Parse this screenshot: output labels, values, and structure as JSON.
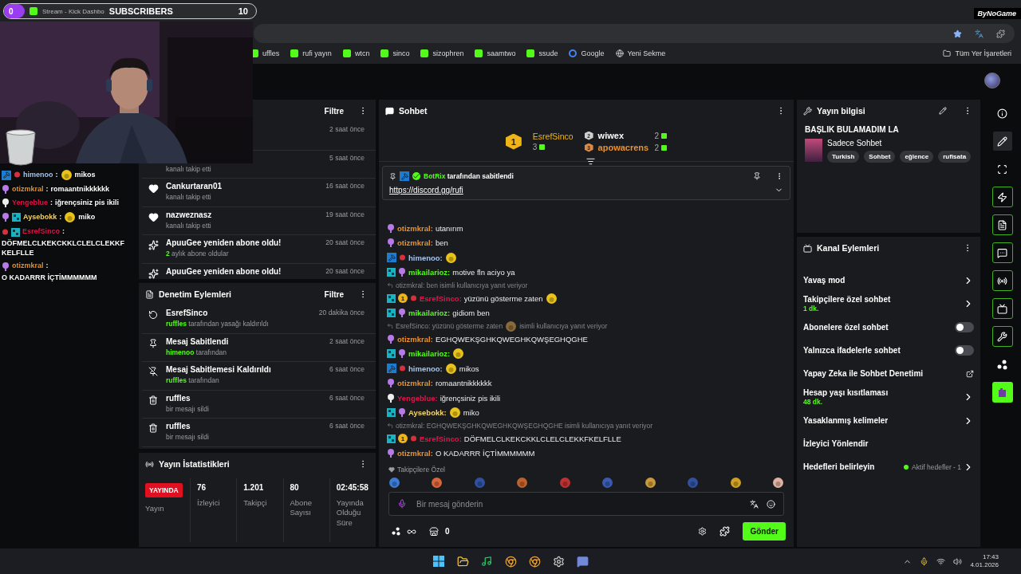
{
  "browser": {
    "bookmarks": [
      {
        "label": "uffles",
        "kind": "kick"
      },
      {
        "label": "rufi yayın",
        "kind": "kick"
      },
      {
        "label": "wtcn",
        "kind": "kick"
      },
      {
        "label": "sinco",
        "kind": "kick"
      },
      {
        "label": "sizophren",
        "kind": "kick"
      },
      {
        "label": "saamtwo",
        "kind": "kick"
      },
      {
        "label": "ssude",
        "kind": "kick"
      },
      {
        "label": "Google",
        "kind": "google"
      },
      {
        "label": "Yeni Sekme",
        "kind": "globe"
      }
    ],
    "all_bookmarks": "Tüm Yer İşaretleri"
  },
  "overlay": {
    "count": "0",
    "tab_title": "Stream - Kick Dashbo",
    "label": "SUBSCRIBERS",
    "goal": "10",
    "brand": "ByNoGame"
  },
  "overlay_chat": [
    {
      "user": "himenoo",
      "color": "#a3c4f3",
      "badges": [
        {
          "kind": "mod"
        },
        {
          "kind": "vip"
        }
      ],
      "sep": ":",
      "parts": [
        {
          "kind": "emote"
        },
        {
          "kind": "text",
          "text": "mikos"
        }
      ]
    },
    {
      "user": "otizmkral",
      "color": "#e8912d",
      "badges": [
        {
          "kind": "sub"
        }
      ],
      "sep": ":",
      "parts": [
        {
          "kind": "text",
          "text": "romaantnikkkkkk"
        }
      ]
    },
    {
      "user": "Yengeblue",
      "color": "#e0144c",
      "badges": [
        {
          "kind": "gifter"
        }
      ],
      "sep": ":",
      "parts": [
        {
          "kind": "text",
          "text": "iğrençsiniz pis ikili"
        }
      ]
    },
    {
      "user": "Aysebokk",
      "color": "#f5d56a",
      "badges": [
        {
          "kind": "sub"
        },
        {
          "kind": "og"
        }
      ],
      "sep": ":",
      "parts": [
        {
          "kind": "emote"
        },
        {
          "kind": "text",
          "text": "miko"
        }
      ]
    },
    {
      "user": "EsrefSinco",
      "color": "#e0144c",
      "badges": [
        {
          "kind": "vip"
        },
        {
          "kind": "og"
        }
      ],
      "sep": ":",
      "parts": [
        {
          "kind": "text",
          "text": "DÖFMELCLKEKCKKLCLELCLEKKFKELFLLE"
        }
      ]
    },
    {
      "user": "otizmkral",
      "color": "#e8912d",
      "badges": [
        {
          "kind": "sub"
        }
      ],
      "sep": ":",
      "parts": [
        {
          "kind": "text",
          "text": "O KADARRR İÇTİMMMMMM"
        }
      ]
    }
  ],
  "events": {
    "filter": "Filtre",
    "items": [
      {
        "time": "2 saat önce"
      },
      {
        "subtitle": "kanalı takip etti",
        "time": "5 saat önce"
      },
      {
        "kind": "follow",
        "name": "Cankurtaran01",
        "subtitle": "kanalı takip etti",
        "time": "16 saat önce"
      },
      {
        "kind": "follow",
        "name": "nazweznasz",
        "subtitle": "kanalı takip etti",
        "time": "19 saat önce"
      },
      {
        "kind": "resub",
        "name": "ApuuGee yeniden abone oldu!",
        "months": "2",
        "subtitle": "aylık abone oldular",
        "time": "20 saat önce"
      },
      {
        "kind": "resub",
        "name": "ApuuGee yeniden abone oldu!",
        "time": "20 saat önce"
      }
    ]
  },
  "moderation": {
    "title": "Denetim Eylemleri",
    "filter": "Filtre",
    "items": [
      {
        "kind": "unban",
        "name": "EsrefSinco",
        "actor": "ruffles",
        "subtitle": "tarafından yasağı kaldırıldı",
        "time": "20 dakika önce"
      },
      {
        "kind": "pin",
        "name": "Mesaj Sabitlendi",
        "actor": "himenoo",
        "subtitle": "tarafından",
        "time": "2 saat önce"
      },
      {
        "kind": "unpin",
        "name": "Mesaj Sabitlemesi Kaldırıldı",
        "actor": "ruffles",
        "subtitle": "tarafından",
        "time": "6 saat önce"
      },
      {
        "kind": "delete",
        "name": "ruffles",
        "subtitle": "bir mesajı sildi",
        "time": "6 saat önce"
      },
      {
        "kind": "delete",
        "name": "ruffles",
        "subtitle": "bir mesajı sildi",
        "time": "6 saat önce"
      }
    ]
  },
  "stats": {
    "title": "Yayın İstatistikleri",
    "live": "YAYINDA",
    "live_label": "Yayın",
    "items": [
      {
        "value": "76",
        "label": "İzleyici"
      },
      {
        "value": "1.201",
        "label": "Takipçi"
      },
      {
        "value": "80",
        "label": "Abone Sayısı"
      },
      {
        "value": "02:45:58",
        "label": "Yayında Olduğu Süre"
      }
    ]
  },
  "chat": {
    "title": "Sohbet",
    "leader": {
      "rank": "1",
      "name": "EsrefSinco",
      "count": "3"
    },
    "runners": [
      {
        "rank": "2",
        "name": "wiwex",
        "count": "2",
        "color": "#ffffff"
      },
      {
        "rank": "3",
        "name": "apowacrens",
        "count": "2",
        "color": "#e8912d"
      }
    ],
    "pinned": {
      "by": "BotRix",
      "text": "tarafından sabitlendi",
      "link": "https://discord.gg/rufi"
    },
    "messages": [
      {
        "kind": "message",
        "user": "otizmkral:",
        "color": "#e8912d",
        "badges": [
          {
            "kind": "sub"
          }
        ],
        "parts": [
          {
            "kind": "text",
            "text": "utanırım"
          }
        ]
      },
      {
        "kind": "message",
        "user": "otizmkral:",
        "color": "#e8912d",
        "badges": [
          {
            "kind": "sub"
          }
        ],
        "parts": [
          {
            "kind": "text",
            "text": "ben"
          }
        ]
      },
      {
        "kind": "message",
        "user": "himenoo:",
        "color": "#a3c4f3",
        "badges": [
          {
            "kind": "mod"
          },
          {
            "kind": "vip"
          }
        ],
        "parts": [
          {
            "kind": "emote"
          }
        ]
      },
      {
        "kind": "message",
        "user": "mikailarioz:",
        "color": "#53fc18",
        "badges": [
          {
            "kind": "og"
          },
          {
            "kind": "sub"
          }
        ],
        "parts": [
          {
            "kind": "text",
            "text": "motive fln aciyo ya"
          }
        ]
      },
      {
        "kind": "reply",
        "text": "otizmkral: ben isimli kullanıcıya yanıt veriyor"
      },
      {
        "kind": "message",
        "user": "EsrefSinco:",
        "color": "#e0144c",
        "badges": [
          {
            "kind": "og"
          },
          {
            "kind": "rank",
            "rank": "1"
          },
          {
            "kind": "vip"
          }
        ],
        "parts": [
          {
            "kind": "text",
            "text": "yüzünü gösterme zaten"
          },
          {
            "kind": "emote"
          }
        ]
      },
      {
        "kind": "message",
        "user": "mikailarioz:",
        "color": "#53fc18",
        "badges": [
          {
            "kind": "og"
          },
          {
            "kind": "sub"
          }
        ],
        "parts": [
          {
            "kind": "text",
            "text": "gidiom ben"
          }
        ]
      },
      {
        "kind": "reply",
        "text": "EsrefSinco: yüzünü gösterme zaten",
        "rest": "isimli kullanıcıya yanıt veriyor"
      },
      {
        "kind": "message",
        "user": "otizmkral:",
        "color": "#e8912d",
        "badges": [
          {
            "kind": "sub"
          }
        ],
        "parts": [
          {
            "kind": "text",
            "text": "EGHQWEKŞGHKQWEGHKQWŞEGHQGHE"
          }
        ]
      },
      {
        "kind": "message",
        "user": "mikailarioz:",
        "color": "#53fc18",
        "badges": [
          {
            "kind": "og"
          },
          {
            "kind": "sub"
          }
        ],
        "parts": [
          {
            "kind": "emote"
          }
        ]
      },
      {
        "kind": "message",
        "user": "himenoo:",
        "color": "#a3c4f3",
        "badges": [
          {
            "kind": "mod"
          },
          {
            "kind": "vip"
          }
        ],
        "parts": [
          {
            "kind": "emote"
          },
          {
            "kind": "text",
            "text": "mikos"
          }
        ]
      },
      {
        "kind": "message",
        "user": "otizmkral:",
        "color": "#e8912d",
        "badges": [
          {
            "kind": "sub"
          }
        ],
        "parts": [
          {
            "kind": "text",
            "text": "romaantnikkkkkk"
          }
        ]
      },
      {
        "kind": "message",
        "user": "Yengeblue:",
        "color": "#e0144c",
        "badges": [
          {
            "kind": "gifter"
          }
        ],
        "parts": [
          {
            "kind": "text",
            "text": "iğrençsiniz pis ikili"
          }
        ]
      },
      {
        "kind": "message",
        "user": "Aysebokk:",
        "color": "#f5d56a",
        "badges": [
          {
            "kind": "og"
          },
          {
            "kind": "sub"
          }
        ],
        "parts": [
          {
            "kind": "emote"
          },
          {
            "kind": "text",
            "text": "miko"
          }
        ]
      },
      {
        "kind": "reply",
        "text": "otizmkral: EGHQWEKŞGHKQWEGHKQWŞEGHQGHE isimli kullanıcıya yanıt veriyor"
      },
      {
        "kind": "message",
        "user": "EsrefSinco:",
        "color": "#e0144c",
        "badges": [
          {
            "kind": "og"
          },
          {
            "kind": "rank",
            "rank": "1"
          },
          {
            "kind": "vip"
          }
        ],
        "parts": [
          {
            "kind": "text",
            "text": "DÖFMELCLKEKCKKLCLELCLEKKFKELFLLE"
          }
        ]
      },
      {
        "kind": "message",
        "user": "otizmkral:",
        "color": "#e8912d",
        "badges": [
          {
            "kind": "sub"
          }
        ],
        "parts": [
          {
            "kind": "text",
            "text": "O KADARRR İÇTİMMMMMM"
          }
        ]
      }
    ],
    "emote_section": "Takipçilere Özel",
    "placeholder": "Bir mesaj gönderin",
    "points": "0",
    "send": "Gönder"
  },
  "stream_info": {
    "title": "Yayın bilgisi",
    "stream_title": "BAŞLIK BULAMADIM LA",
    "category": "Sadece Sohbet",
    "tags": [
      "Turkish",
      "Sohbet",
      "eğlence",
      "rufisata"
    ]
  },
  "channel_actions": {
    "title": "Kanal Eylemleri",
    "items": [
      {
        "kind": "link",
        "label": "Yavaş mod"
      },
      {
        "kind": "link",
        "label": "Takipçilere özel sohbet",
        "value": "1 dk."
      },
      {
        "kind": "toggle",
        "label": "Abonelere özel sohbet",
        "on": false
      },
      {
        "kind": "toggle",
        "label": "Yalnızca ifadelerle sohbet",
        "on": false
      },
      {
        "kind": "external",
        "label": "Yapay Zeka ile Sohbet Denetimi"
      },
      {
        "kind": "link",
        "label": "Hesap yaşı kısıtlaması",
        "value": "48 dk."
      },
      {
        "kind": "link",
        "label": "Yasaklanmış kelimeler"
      },
      {
        "kind": "plain",
        "label": "İzleyici Yönlendir"
      },
      {
        "kind": "goal",
        "label": "Hedefleri belirleyin",
        "status": "Aktif hedefler - 1"
      }
    ]
  },
  "rail": [
    {
      "kind": "info",
      "selected": false,
      "added": false
    },
    {
      "kind": "edit",
      "selected": true,
      "added": false
    },
    {
      "kind": "scan",
      "selected": false,
      "added": false
    },
    {
      "kind": "bolt",
      "selected": false,
      "added": true
    },
    {
      "kind": "doc",
      "selected": false,
      "added": true
    },
    {
      "kind": "chat",
      "selected": false,
      "added": true
    },
    {
      "kind": "broadcast",
      "selected": false,
      "added": true
    },
    {
      "kind": "layout",
      "selected": false,
      "added": true
    },
    {
      "kind": "wrench",
      "selected": false,
      "added": true
    },
    {
      "kind": "dots",
      "selected": false,
      "added": false
    },
    {
      "kind": "app",
      "selected": false,
      "added": false
    }
  ],
  "taskbar": {
    "time": "17:43",
    "date": "4.01.2026"
  }
}
